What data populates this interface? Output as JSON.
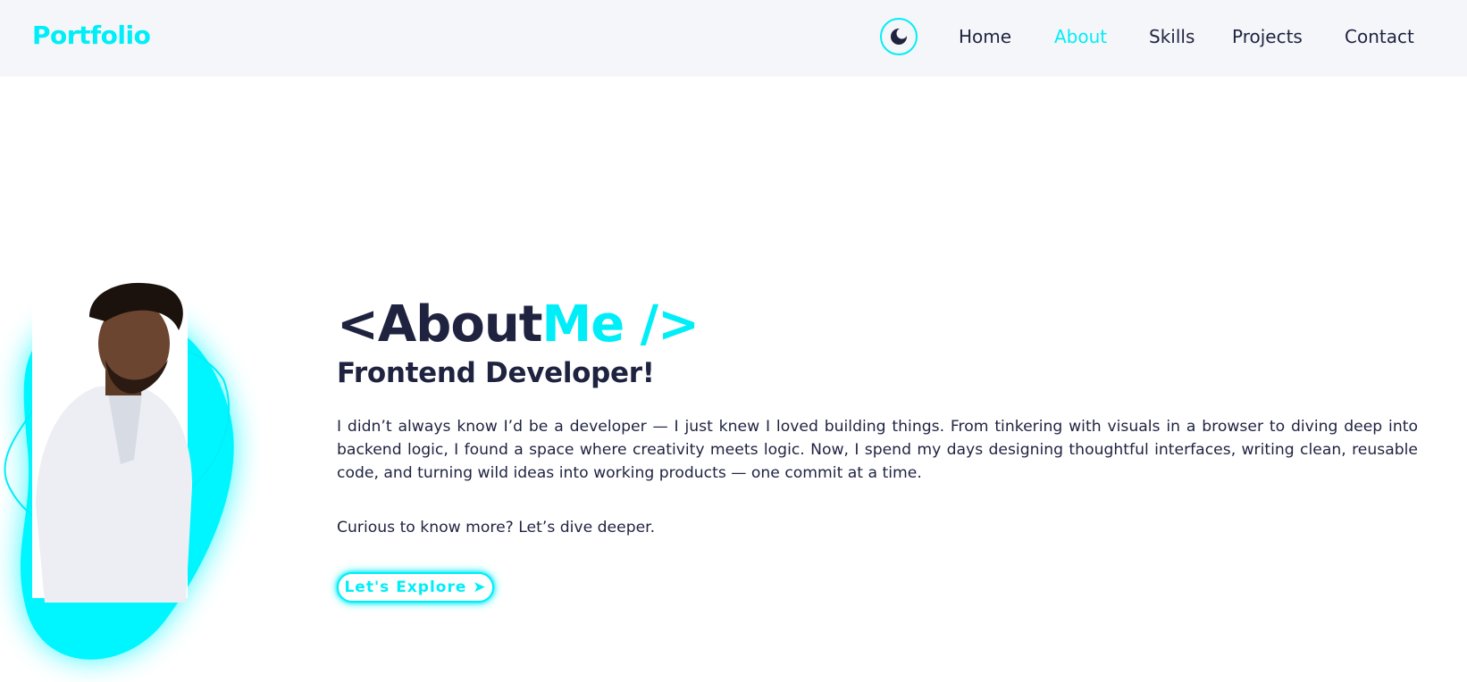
{
  "navbar": {
    "logo": "Portfolio",
    "theme_toggle_icon": "moon-icon",
    "links": [
      {
        "label": "Home",
        "active": false
      },
      {
        "label": "About",
        "active": true
      },
      {
        "label": "Skills",
        "active": false
      },
      {
        "label": "Projects",
        "active": false
      },
      {
        "label": "Contact",
        "active": false
      }
    ]
  },
  "about": {
    "heading_open": "<",
    "heading_word1": "About",
    "heading_word2": "Me",
    "heading_close": " />",
    "subheading": "Frontend Developer!",
    "bio": "I didn’t always know I’d be a developer — I just knew I loved building things. From tinkering with visuals in a browser to diving deep into backend logic, I found a space where creativity meets logic. Now, I spend my days designing thoughtful interfaces, writing clean, reusable code, and turning wild ideas into working products — one commit at a time.",
    "cta_text": "Curious to know more? Let’s dive deeper.",
    "button_label": "Let's Explore ➤"
  },
  "colors": {
    "accent": "#00eef7",
    "text_dark": "#1f2340",
    "nav_background": "#f5f6f9",
    "page_background": "#ffffff"
  }
}
